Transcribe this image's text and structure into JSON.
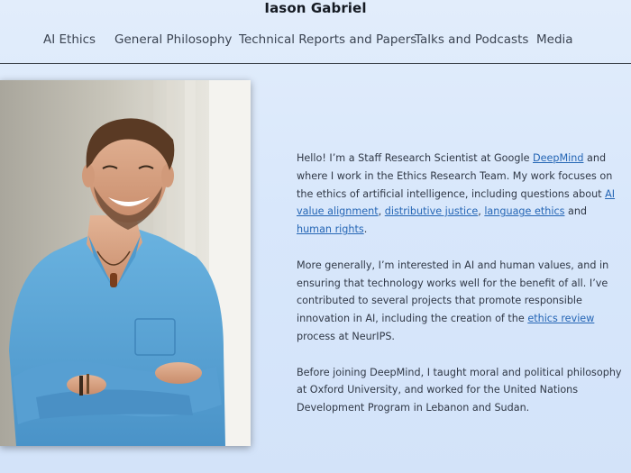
{
  "site": {
    "title": "Iason Gabriel"
  },
  "nav": {
    "items": [
      {
        "label": "AI Ethics"
      },
      {
        "label": "General Philosophy"
      },
      {
        "label": "Technical Reports and Papers"
      },
      {
        "label": "Talks and Podcasts"
      },
      {
        "label": "Media"
      }
    ]
  },
  "bio": {
    "p1": {
      "t1": "Hello! I’m a Staff Research Scientist at Google ",
      "link_deepmind": "DeepMind",
      "t2": " and where I work in the Ethics Research Team. My work focuses on the ethics of artificial intelligence, including questions about ",
      "link_value_alignment": "AI value alignment",
      "t3": ", ",
      "link_distributive_justice": "distributive justice",
      "t4": ", ",
      "link_language_ethics": "language ethics",
      "t5": " and ",
      "link_human_rights": "human rights",
      "t6": "."
    },
    "p2": {
      "t1": "More generally, I’m interested in AI and human values, and in ensuring that technology works well for the benefit of all. I’ve contributed to several projects that promote responsible innovation in AI, including the creation of the ",
      "link_ethics_review": "ethics review",
      "t2": " process at NeurIPS."
    },
    "p3": {
      "text": "Before joining DeepMind, I taught moral and political philosophy at Oxford University, and worked for the United Nations Development Program in Lebanon and Sudan."
    }
  },
  "colors": {
    "background": "#d8e7fb",
    "link": "#2566b5",
    "shirt": "#5ba6d6"
  },
  "icons": {
    "portrait": "portrait-photo"
  }
}
